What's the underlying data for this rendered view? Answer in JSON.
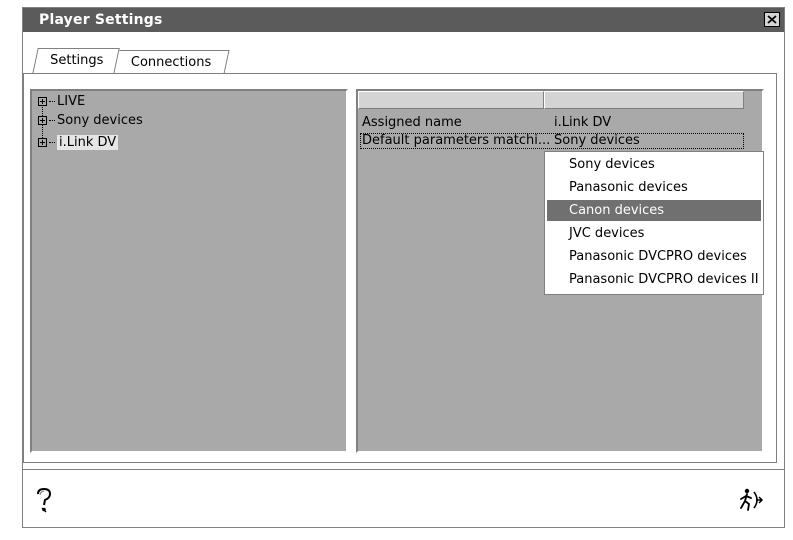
{
  "window": {
    "title": "Player Settings"
  },
  "tabs": [
    {
      "label": "Settings",
      "active": true
    },
    {
      "label": "Connections",
      "active": false
    }
  ],
  "tree": {
    "items": [
      {
        "label": "LIVE",
        "selected": false
      },
      {
        "label": "Sony devices",
        "selected": false
      },
      {
        "label": "i.Link DV",
        "selected": true
      }
    ]
  },
  "properties": {
    "columns": [
      "",
      ""
    ],
    "rows": [
      {
        "name": "Assigned name",
        "value": "i.Link DV"
      },
      {
        "name": "Default parameters matchi...",
        "value": "Sony devices"
      }
    ]
  },
  "dropdown": {
    "options": [
      "Sony devices",
      "Panasonic devices",
      "Canon devices",
      "JVC devices",
      "Panasonic DVCPRO devices",
      "Panasonic DVCPRO devices II"
    ],
    "highlighted": "Canon devices"
  },
  "icons": {
    "help": "help-question-icon",
    "exit": "exit-door-icon",
    "close": "close-x-icon"
  },
  "colors": {
    "titlebar": "#5b5b5b",
    "pane_background": "#a9a9a9",
    "highlight": "#707070"
  }
}
